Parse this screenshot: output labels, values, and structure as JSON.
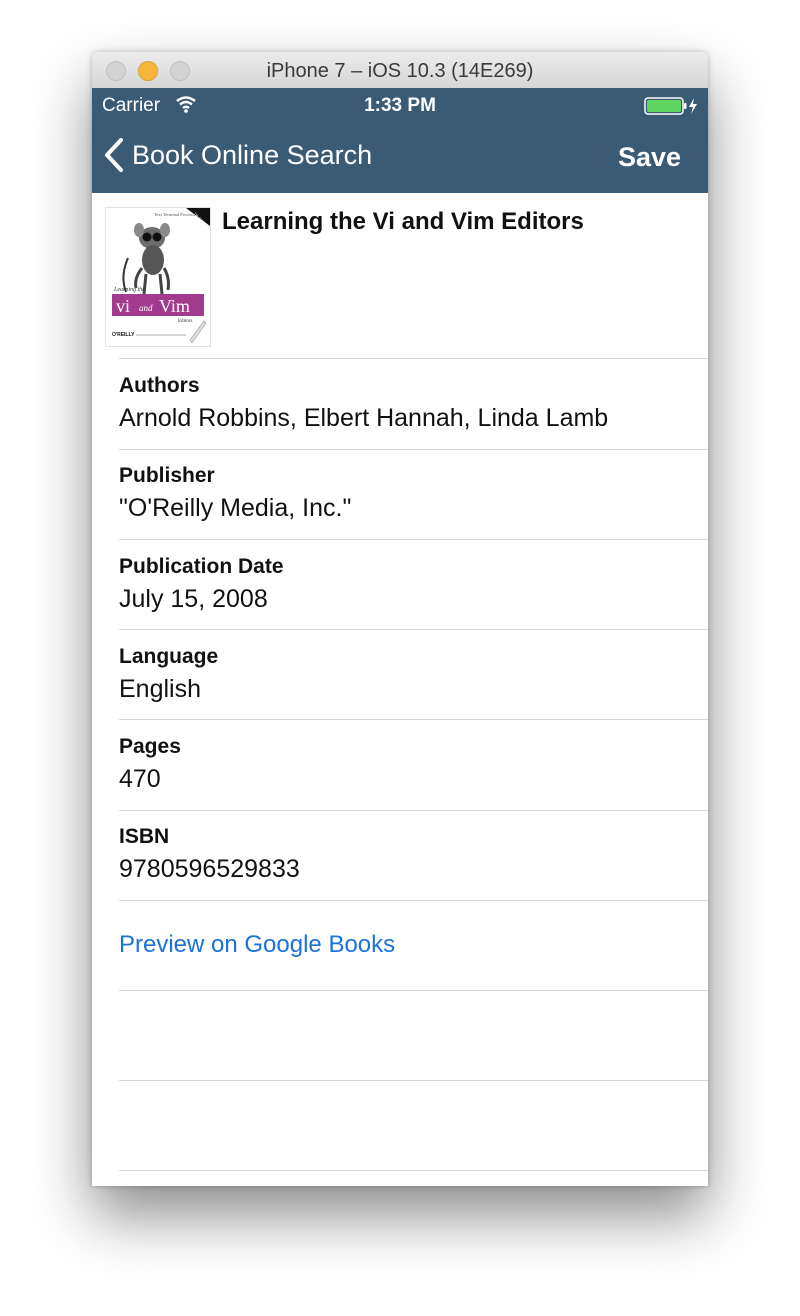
{
  "window": {
    "title": "iPhone 7 – iOS 10.3 (14E269)"
  },
  "status_bar": {
    "carrier": "Carrier",
    "time": "1:33 PM",
    "battery_color": "#5fd35f"
  },
  "nav": {
    "back_label": "Book Online Search",
    "save_label": "Save",
    "bar_color": "#3b5a74"
  },
  "book": {
    "title": "Learning the Vi and Vim Editors",
    "cover": {
      "series": "Text Terminal Processing",
      "learning": "Learning the",
      "vi": "vi",
      "and": "and",
      "vim": "Vim",
      "editors": "Editors",
      "publisher": "O'REILLY",
      "edition": "7th Edition",
      "accent_color": "#a23a8d"
    }
  },
  "details": [
    {
      "label": "Authors",
      "value": "Arnold Robbins, Elbert Hannah, Linda Lamb"
    },
    {
      "label": "Publisher",
      "value": "\"O'Reilly Media, Inc.\""
    },
    {
      "label": "Publication Date",
      "value": "July 15, 2008"
    },
    {
      "label": "Language",
      "value": "English"
    },
    {
      "label": "Pages",
      "value": "470"
    },
    {
      "label": "ISBN",
      "value": "9780596529833"
    }
  ],
  "preview_link": {
    "label": "Preview on Google Books",
    "color": "#1a73d9"
  }
}
